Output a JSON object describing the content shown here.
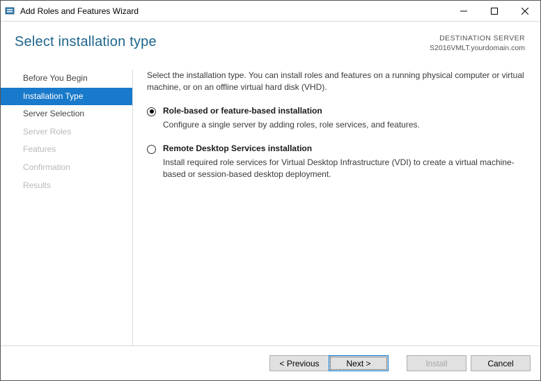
{
  "window": {
    "title": "Add Roles and Features Wizard"
  },
  "header": {
    "page_title": "Select installation type",
    "destination_label": "DESTINATION SERVER",
    "destination_name": "S2016VMLT.yourdomain.com"
  },
  "sidebar": {
    "steps": [
      {
        "label": "Before You Begin",
        "state": "normal"
      },
      {
        "label": "Installation Type",
        "state": "active"
      },
      {
        "label": "Server Selection",
        "state": "normal"
      },
      {
        "label": "Server Roles",
        "state": "disabled"
      },
      {
        "label": "Features",
        "state": "disabled"
      },
      {
        "label": "Confirmation",
        "state": "disabled"
      },
      {
        "label": "Results",
        "state": "disabled"
      }
    ]
  },
  "content": {
    "intro": "Select the installation type. You can install roles and features on a running physical computer or virtual machine, or on an offline virtual hard disk (VHD).",
    "options": [
      {
        "title": "Role-based or feature-based installation",
        "desc": "Configure a single server by adding roles, role services, and features.",
        "selected": true
      },
      {
        "title": "Remote Desktop Services installation",
        "desc": "Install required role services for Virtual Desktop Infrastructure (VDI) to create a virtual machine-based or session-based desktop deployment.",
        "selected": false
      }
    ]
  },
  "footer": {
    "previous": "< Previous",
    "next": "Next >",
    "install": "Install",
    "cancel": "Cancel"
  }
}
